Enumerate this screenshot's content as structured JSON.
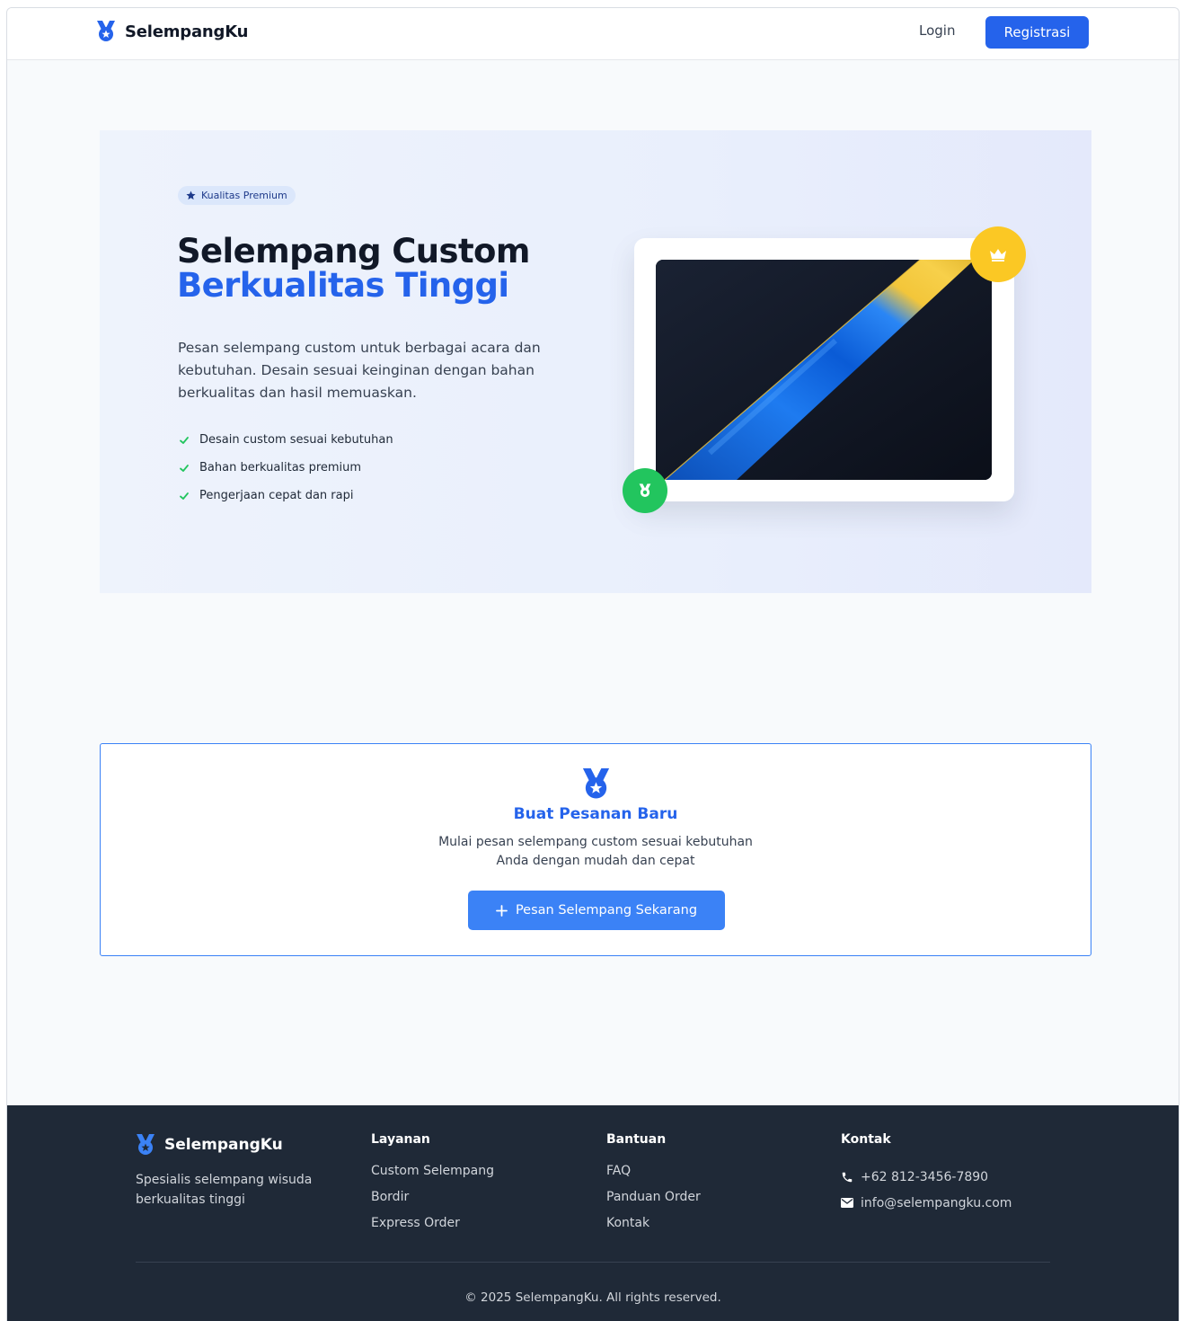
{
  "nav": {
    "brand": "SelempangKu",
    "login_label": "Login",
    "register_label": "Registrasi"
  },
  "hero": {
    "badge": "Kualitas Premium",
    "title_line1": "Selempang Custom",
    "title_line2": "Berkualitas Tinggi",
    "description": "Pesan selempang custom untuk berbagai acara dan kebutuhan. Desain sesuai keinginan dengan bahan berkualitas dan hasil memuaskan.",
    "features": [
      "Desain custom sesuai kebutuhan",
      "Bahan berkualitas premium",
      "Pengerjaan cepat dan rapi"
    ]
  },
  "cta": {
    "title": "Buat Pesanan Baru",
    "description_line1": "Mulai pesan selempang custom sesuai kebutuhan",
    "description_line2": "Anda dengan mudah dan cepat",
    "button_label": "Pesan Selempang Sekarang"
  },
  "footer": {
    "brand": "SelempangKu",
    "tagline": "Spesialis selempang wisuda berkualitas tinggi",
    "columns": [
      {
        "title": "Layanan",
        "links": [
          "Custom Selempang",
          "Bordir",
          "Express Order"
        ]
      },
      {
        "title": "Bantuan",
        "links": [
          "FAQ",
          "Panduan Order",
          "Kontak"
        ]
      }
    ],
    "contact": {
      "title": "Kontak",
      "phone": "+62 812-3456-7890",
      "email": "info@selempangku.com"
    },
    "copyright": "© 2025 SelempangKu. All rights reserved."
  },
  "colors": {
    "primary": "#2563eb",
    "accent_blue": "#3b82f6",
    "crown_badge": "#fbc824",
    "medal_badge": "#22c55e",
    "check": "#22c55e",
    "footer_bg": "#1f2937"
  },
  "icons": {
    "brand": "medal-icon",
    "badge": "star-icon",
    "features": "check-icon",
    "crown": "crown-icon",
    "cta": "plus-icon",
    "phone": "phone-icon",
    "email": "envelope-icon"
  }
}
